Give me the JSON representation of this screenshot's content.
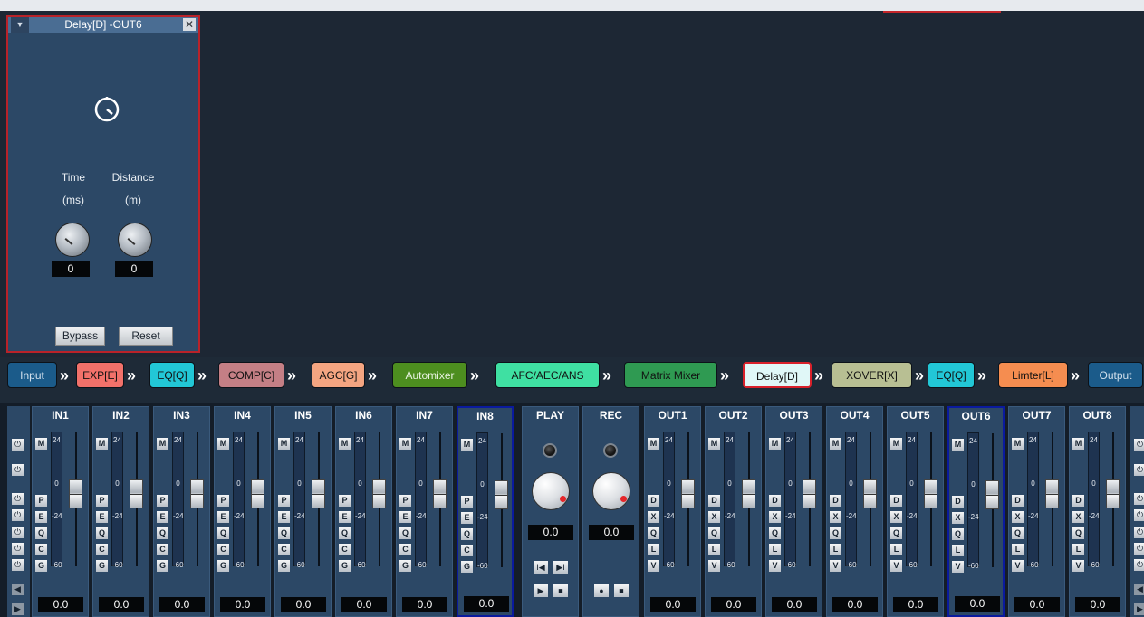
{
  "panel": {
    "title": "Delay[D] -OUT6",
    "collapse_icon": "▼",
    "close_icon": "✕",
    "time_label": "Time",
    "time_unit": "(ms)",
    "distance_label": "Distance",
    "distance_unit": "(m)",
    "time_value": "0",
    "distance_value": "0",
    "bypass": "Bypass",
    "reset": "Reset",
    "timer_icon": "stopwatch-icon"
  },
  "chain": [
    {
      "label": "Input",
      "bg": "#1b5b8a",
      "fg": "#d2e0ec"
    },
    {
      "label": "EXP[E]",
      "bg": "#f2716a",
      "fg": "#111"
    },
    {
      "label": "EQ[Q]",
      "bg": "#22c7d6",
      "fg": "#111"
    },
    {
      "label": "COMP[C]",
      "bg": "#c47f85",
      "fg": "#111"
    },
    {
      "label": "AGC[G]",
      "bg": "#f4a581",
      "fg": "#111"
    },
    {
      "label": "Automixer",
      "bg": "#4d8e1f",
      "fg": "#e8f3e0"
    },
    {
      "label": "AFC/AEC/ANS",
      "bg": "#3fe0a2",
      "fg": "#111"
    },
    {
      "label": "Matrix Mixer",
      "bg": "#2f9a52",
      "fg": "#111"
    },
    {
      "label": "Delay[D]",
      "bg": "#e0f7f7",
      "fg": "#111"
    },
    {
      "label": "XOVER[X]",
      "bg": "#b8bf93",
      "fg": "#111"
    },
    {
      "label": "EQ[Q]",
      "bg": "#22c7d6",
      "fg": "#111"
    },
    {
      "label": "Limter[L]",
      "bg": "#f58d50",
      "fg": "#111"
    },
    {
      "label": "Output",
      "bg": "#1b5b8a",
      "fg": "#d2e0ec"
    }
  ],
  "inputs": [
    {
      "name": "IN1",
      "value": "0.0"
    },
    {
      "name": "IN2",
      "value": "0.0"
    },
    {
      "name": "IN3",
      "value": "0.0"
    },
    {
      "name": "IN4",
      "value": "0.0"
    },
    {
      "name": "IN5",
      "value": "0.0"
    },
    {
      "name": "IN6",
      "value": "0.0"
    },
    {
      "name": "IN7",
      "value": "0.0"
    },
    {
      "name": "IN8",
      "value": "0.0"
    }
  ],
  "in_buttons": [
    "M",
    "P",
    "E",
    "Q",
    "C",
    "G"
  ],
  "out_buttons": [
    "M",
    "D",
    "X",
    "Q",
    "L",
    "V"
  ],
  "meter_ticks": [
    "24",
    "0",
    "-24",
    "-60"
  ],
  "play": {
    "label": "PLAY",
    "value": "0.0",
    "prev": "I◀",
    "next": "▶I",
    "play": "▶",
    "stop": "■"
  },
  "rec": {
    "label": "REC",
    "value": "0.0",
    "record": "●",
    "stop": "■"
  },
  "outputs": [
    {
      "name": "OUT1",
      "value": "0.0"
    },
    {
      "name": "OUT2",
      "value": "0.0"
    },
    {
      "name": "OUT3",
      "value": "0.0"
    },
    {
      "name": "OUT4",
      "value": "0.0"
    },
    {
      "name": "OUT5",
      "value": "0.0"
    },
    {
      "name": "OUT6",
      "value": "0.0"
    },
    {
      "name": "OUT7",
      "value": "0.0"
    },
    {
      "name": "OUT8",
      "value": "0.0"
    }
  ],
  "power_icon": "⏻"
}
